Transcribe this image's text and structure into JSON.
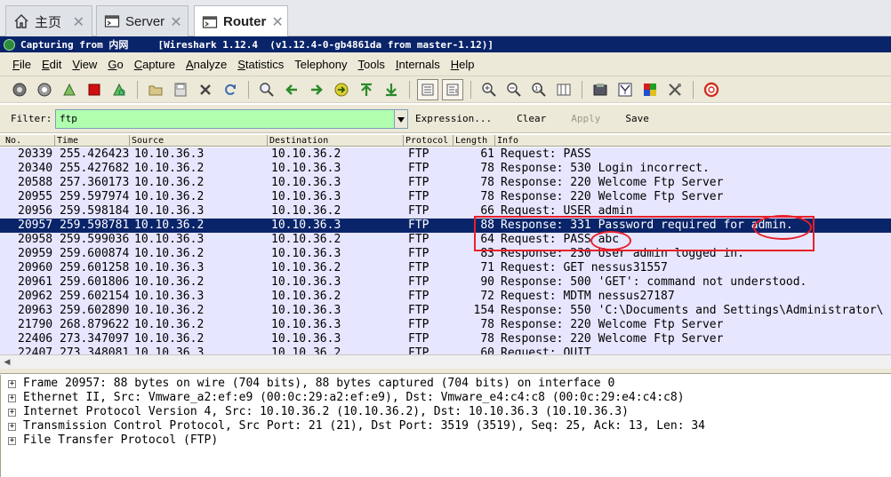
{
  "browser_tabs": [
    {
      "label": "主页",
      "icon": "home-icon",
      "active": false
    },
    {
      "label": "Server",
      "icon": "console-icon",
      "active": false
    },
    {
      "label": "Router",
      "icon": "console-icon",
      "active": true
    }
  ],
  "window": {
    "title": "Capturing from 内网     [Wireshark 1.12.4  (v1.12.4-0-gb4861da from master-1.12)]"
  },
  "menu": [
    {
      "label": "File",
      "u": "F",
      "rest": "ile"
    },
    {
      "label": "Edit",
      "u": "E",
      "rest": "dit"
    },
    {
      "label": "View",
      "u": "V",
      "rest": "iew"
    },
    {
      "label": "Go",
      "u": "G",
      "rest": "o"
    },
    {
      "label": "Capture",
      "u": "C",
      "rest": "apture"
    },
    {
      "label": "Analyze",
      "u": "A",
      "rest": "nalyze"
    },
    {
      "label": "Statistics",
      "u": "S",
      "rest": "tatistics"
    },
    {
      "label": "Telephony",
      "u": "",
      "rest": "Telephony"
    },
    {
      "label": "Tools",
      "u": "T",
      "rest": "ools"
    },
    {
      "label": "Internals",
      "u": "I",
      "rest": "nternals"
    },
    {
      "label": "Help",
      "u": "H",
      "rest": "elp"
    }
  ],
  "filter": {
    "label": "Filter:",
    "value": "ftp",
    "expression": "Expression...",
    "clear": "Clear",
    "apply": "Apply",
    "save": "Save",
    "valid_color": "#afffaf"
  },
  "columns": [
    "No.",
    "Time",
    "Source",
    "Destination",
    "Protocol",
    "Length",
    "Info"
  ],
  "packets": [
    {
      "no": "20339",
      "time": "255.426423",
      "src": "10.10.36.3",
      "dst": "10.10.36.2",
      "proto": "FTP",
      "len": "61",
      "info": "Request: PASS"
    },
    {
      "no": "20340",
      "time": "255.427682",
      "src": "10.10.36.2",
      "dst": "10.10.36.3",
      "proto": "FTP",
      "len": "78",
      "info": "Response: 530 Login incorrect."
    },
    {
      "no": "20588",
      "time": "257.360173",
      "src": "10.10.36.2",
      "dst": "10.10.36.3",
      "proto": "FTP",
      "len": "78",
      "info": "Response: 220 Welcome Ftp Server"
    },
    {
      "no": "20955",
      "time": "259.597974",
      "src": "10.10.36.2",
      "dst": "10.10.36.3",
      "proto": "FTP",
      "len": "78",
      "info": "Response: 220 Welcome Ftp Server"
    },
    {
      "no": "20956",
      "time": "259.598184",
      "src": "10.10.36.3",
      "dst": "10.10.36.2",
      "proto": "FTP",
      "len": "66",
      "info": "Request: USER admin"
    },
    {
      "no": "20957",
      "time": "259.598781",
      "src": "10.10.36.2",
      "dst": "10.10.36.3",
      "proto": "FTP",
      "len": "88",
      "info": "Response: 331 Password required for admin."
    },
    {
      "no": "20958",
      "time": "259.599036",
      "src": "10.10.36.3",
      "dst": "10.10.36.2",
      "proto": "FTP",
      "len": "64",
      "info": "Request: PASS abc"
    },
    {
      "no": "20959",
      "time": "259.600874",
      "src": "10.10.36.2",
      "dst": "10.10.36.3",
      "proto": "FTP",
      "len": "83",
      "info": "Response: 230 User admin logged in."
    },
    {
      "no": "20960",
      "time": "259.601258",
      "src": "10.10.36.3",
      "dst": "10.10.36.2",
      "proto": "FTP",
      "len": "71",
      "info": "Request: GET nessus31557"
    },
    {
      "no": "20961",
      "time": "259.601806",
      "src": "10.10.36.2",
      "dst": "10.10.36.3",
      "proto": "FTP",
      "len": "90",
      "info": "Response: 500 'GET': command not understood."
    },
    {
      "no": "20962",
      "time": "259.602154",
      "src": "10.10.36.3",
      "dst": "10.10.36.2",
      "proto": "FTP",
      "len": "72",
      "info": "Request: MDTM nessus27187"
    },
    {
      "no": "20963",
      "time": "259.602890",
      "src": "10.10.36.2",
      "dst": "10.10.36.3",
      "proto": "FTP",
      "len": "154",
      "info": "Response: 550 'C:\\Documents and Settings\\Administrator\\"
    },
    {
      "no": "21790",
      "time": "268.879622",
      "src": "10.10.36.2",
      "dst": "10.10.36.3",
      "proto": "FTP",
      "len": "78",
      "info": "Response: 220 Welcome Ftp Server"
    },
    {
      "no": "22406",
      "time": "273.347097",
      "src": "10.10.36.2",
      "dst": "10.10.36.3",
      "proto": "FTP",
      "len": "78",
      "info": "Response: 220 Welcome Ftp Server"
    },
    {
      "no": "22407",
      "time": "273.348081",
      "src": "10.10.36.3",
      "dst": "10.10.36.2",
      "proto": "FTP",
      "len": "60",
      "info": "Request: QUIT"
    }
  ],
  "selected_packet": "20957",
  "details": [
    "Frame 20957: 88 bytes on wire (704 bits), 88 bytes captured (704 bits) on interface 0",
    "Ethernet II, Src: Vmware_a2:ef:e9 (00:0c:29:a2:ef:e9), Dst: Vmware_e4:c4:c8 (00:0c:29:e4:c4:c8)",
    "Internet Protocol Version 4, Src: 10.10.36.2 (10.10.36.2), Dst: 10.10.36.3 (10.10.36.3)",
    "Transmission Control Protocol, Src Port: 21 (21), Dst Port: 3519 (3519), Seq: 25, Ack: 13, Len: 34",
    "File Transfer Protocol (FTP)"
  ],
  "colors": {
    "row_bg": "#e7e6ff",
    "selected_bg": "#0a246a",
    "annotation": "#e8202a"
  }
}
